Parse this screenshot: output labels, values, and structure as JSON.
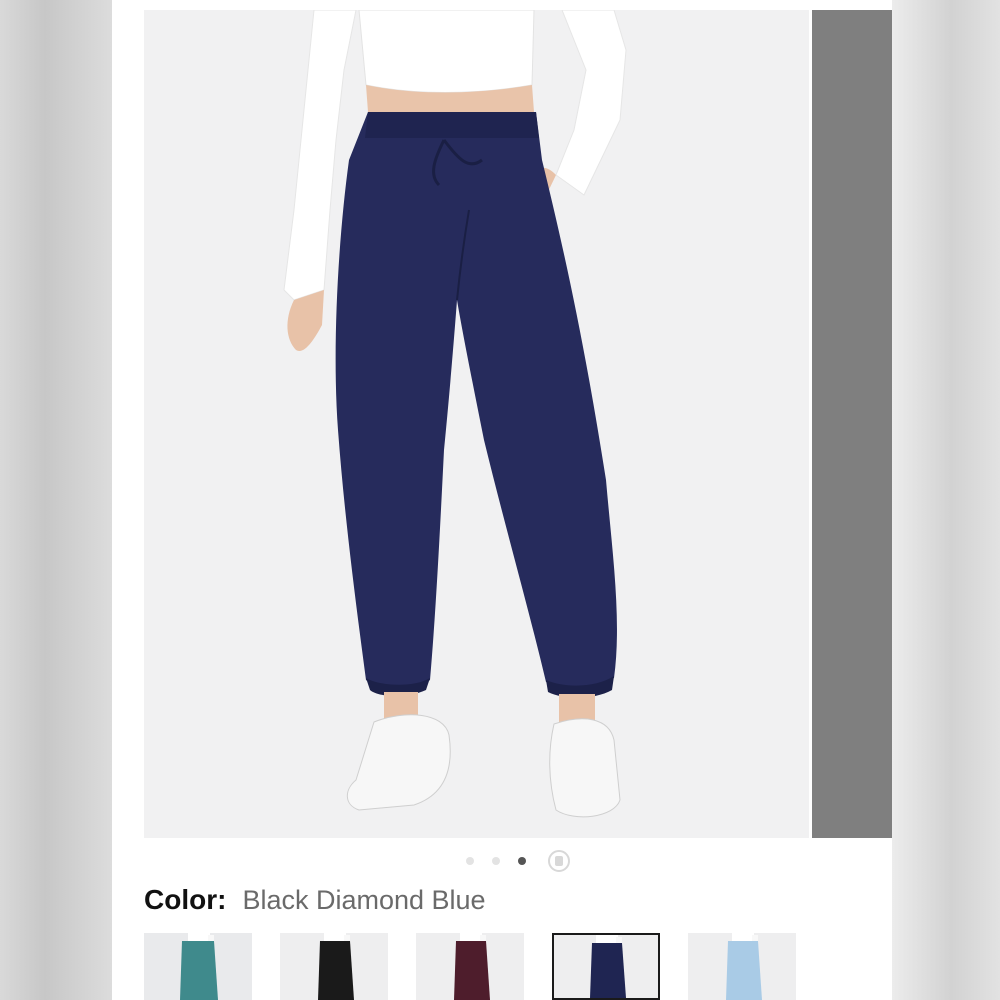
{
  "product_page": {
    "image_alt": "Navy blue drawstring jogger pants with cinched ankles worn with a white crop top and white sneakers",
    "carousel": {
      "slide_count": 4,
      "active_index": 2,
      "last_is_video": true
    },
    "color": {
      "label": "Color:",
      "value": "Black Diamond Blue"
    },
    "swatches": [
      {
        "color_name": "teal",
        "hex": "#3f8a8c"
      },
      {
        "color_name": "black",
        "hex": "#1a1a1a"
      },
      {
        "color_name": "burgundy",
        "hex": "#4e1d2c"
      },
      {
        "color_name": "navy",
        "hex": "#1f2552",
        "selected": true
      },
      {
        "color_name": "light blue",
        "hex": "#a9cbe6"
      }
    ]
  }
}
